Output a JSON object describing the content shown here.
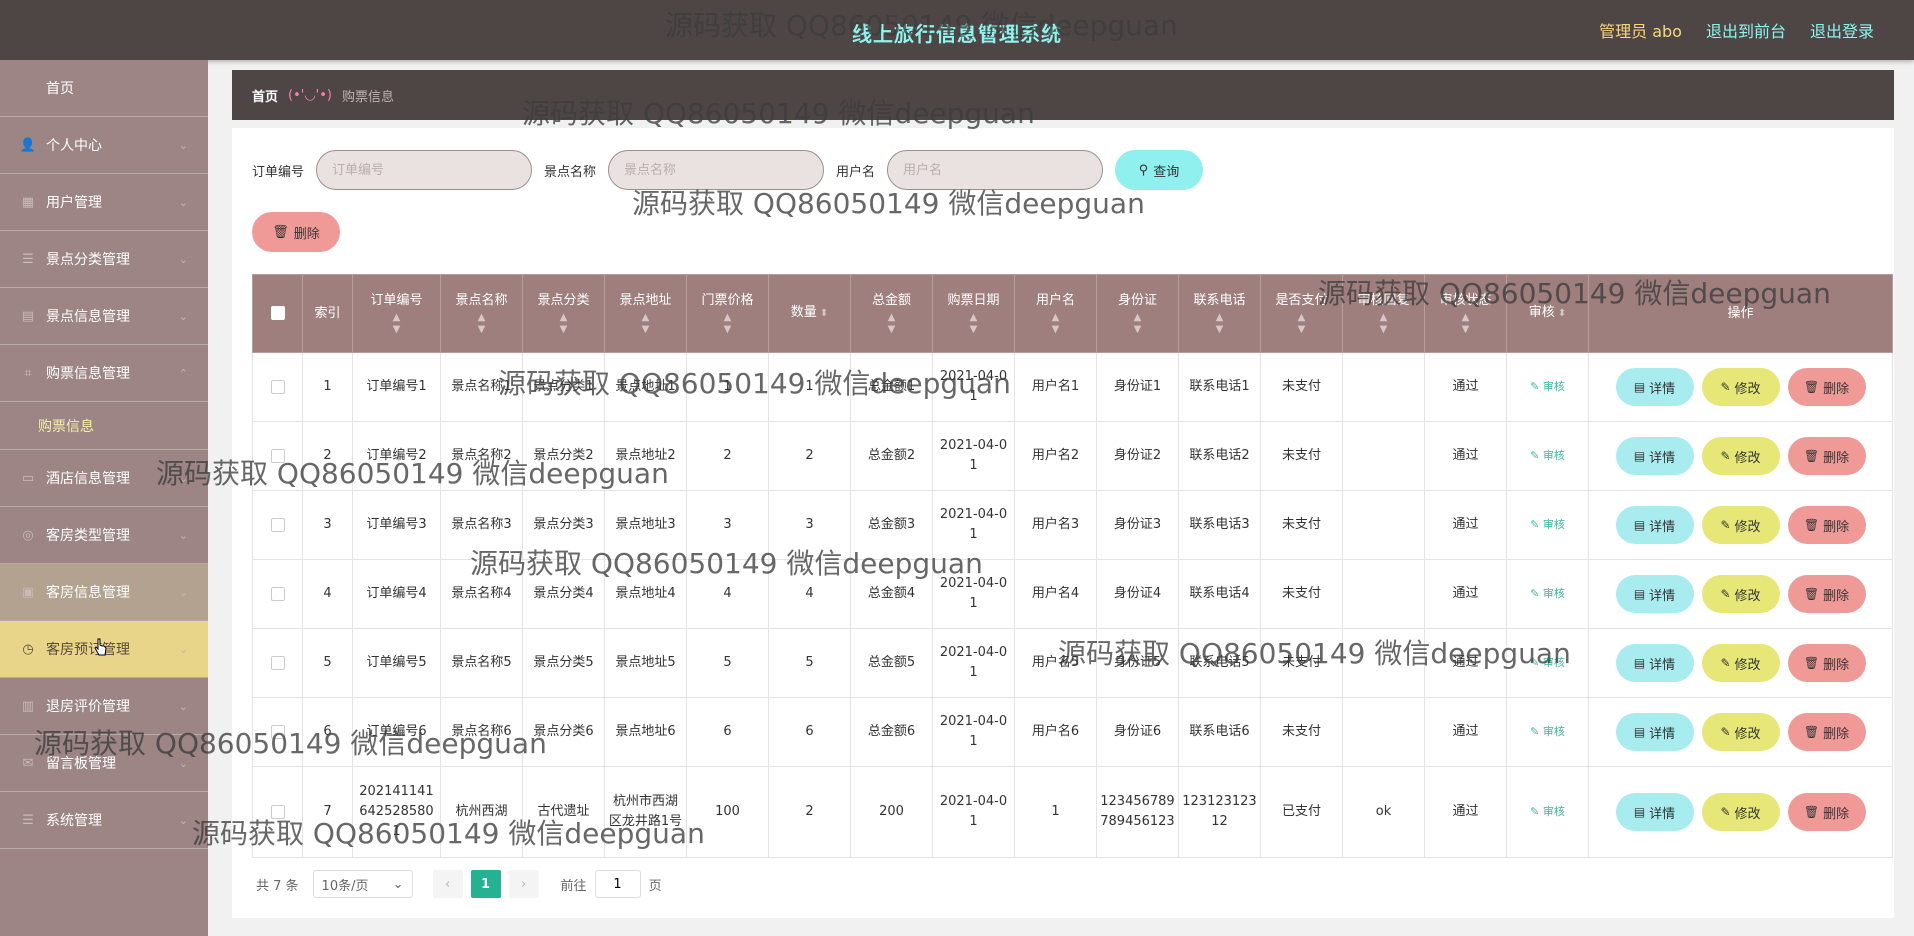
{
  "header": {
    "title": "线上旅行信息管理系统",
    "admin_label": "管理员 abo",
    "front_link": "退出到前台",
    "logout_link": "退出登录"
  },
  "sidebar": {
    "home": "首页",
    "items": [
      {
        "label": "个人中心",
        "icon": "person-icon"
      },
      {
        "label": "用户管理",
        "icon": "user-icon"
      },
      {
        "label": "景点分类管理",
        "icon": "list-icon"
      },
      {
        "label": "景点信息管理",
        "icon": "list-icon"
      },
      {
        "label": "购票信息管理",
        "icon": "ticket-icon"
      },
      {
        "label": "酒店信息管理",
        "icon": "hotel-icon"
      },
      {
        "label": "客房类型管理",
        "icon": "room-icon"
      },
      {
        "label": "客房信息管理",
        "icon": "room-icon"
      },
      {
        "label": "客房预订管理",
        "icon": "booking-icon"
      },
      {
        "label": "退房评价管理",
        "icon": "comment-icon"
      },
      {
        "label": "留言板管理",
        "icon": "message-icon"
      },
      {
        "label": "系统管理",
        "icon": "settings-icon"
      }
    ],
    "submenu_label": "购票信息"
  },
  "breadcrumb": {
    "home": "首页",
    "separator": "(•'◡'•)",
    "current": "购票信息"
  },
  "search": {
    "order_label": "订单编号",
    "order_placeholder": "订单编号",
    "spot_label": "景点名称",
    "spot_placeholder": "景点名称",
    "user_label": "用户名",
    "user_placeholder": "用户名",
    "query_button": "查询",
    "delete_button": "删除"
  },
  "table": {
    "columns": [
      "索引",
      "订单编号",
      "景点名称",
      "景点分类",
      "景点地址",
      "门票价格",
      "数量",
      "总金额",
      "购票日期",
      "用户名",
      "身份证",
      "联系电话",
      "是否支付",
      "审核回复",
      "审核状态",
      "审核",
      "操作"
    ],
    "audit_link": "审核",
    "btn_detail": "详情",
    "btn_edit": "修改",
    "btn_delete": "删除",
    "rows": [
      {
        "index": "1",
        "order": "订单编号1",
        "spot": "景点名称1",
        "category": "景点分类1",
        "address": "景点地址1",
        "price": "1",
        "qty": "1",
        "total": "总金额1",
        "date": "2021-04-01",
        "user": "用户名1",
        "idcard": "身份证1",
        "phone": "联系电话1",
        "paid": "未支付",
        "reply": "",
        "status": "通过"
      },
      {
        "index": "2",
        "order": "订单编号2",
        "spot": "景点名称2",
        "category": "景点分类2",
        "address": "景点地址2",
        "price": "2",
        "qty": "2",
        "total": "总金额2",
        "date": "2021-04-01",
        "user": "用户名2",
        "idcard": "身份证2",
        "phone": "联系电话2",
        "paid": "未支付",
        "reply": "",
        "status": "通过"
      },
      {
        "index": "3",
        "order": "订单编号3",
        "spot": "景点名称3",
        "category": "景点分类3",
        "address": "景点地址3",
        "price": "3",
        "qty": "3",
        "total": "总金额3",
        "date": "2021-04-01",
        "user": "用户名3",
        "idcard": "身份证3",
        "phone": "联系电话3",
        "paid": "未支付",
        "reply": "",
        "status": "通过"
      },
      {
        "index": "4",
        "order": "订单编号4",
        "spot": "景点名称4",
        "category": "景点分类4",
        "address": "景点地址4",
        "price": "4",
        "qty": "4",
        "total": "总金额4",
        "date": "2021-04-01",
        "user": "用户名4",
        "idcard": "身份证4",
        "phone": "联系电话4",
        "paid": "未支付",
        "reply": "",
        "status": "通过"
      },
      {
        "index": "5",
        "order": "订单编号5",
        "spot": "景点名称5",
        "category": "景点分类5",
        "address": "景点地址5",
        "price": "5",
        "qty": "5",
        "total": "总金额5",
        "date": "2021-04-01",
        "user": "用户名5",
        "idcard": "身份证5",
        "phone": "联系电话5",
        "paid": "未支付",
        "reply": "",
        "status": "通过"
      },
      {
        "index": "6",
        "order": "订单编号6",
        "spot": "景点名称6",
        "category": "景点分类6",
        "address": "景点地址6",
        "price": "6",
        "qty": "6",
        "total": "总金额6",
        "date": "2021-04-01",
        "user": "用户名6",
        "idcard": "身份证6",
        "phone": "联系电话6",
        "paid": "未支付",
        "reply": "",
        "status": "通过"
      },
      {
        "index": "7",
        "order": "2021411416425285801",
        "spot": "杭州西湖",
        "category": "古代遗址",
        "address": "杭州市西湖区龙井路1号",
        "price": "100",
        "qty": "2",
        "total": "200",
        "date": "2021-04-01",
        "user": "1",
        "idcard": "123456789789456123",
        "phone": "12312312312",
        "paid": "已支付",
        "reply": "ok",
        "status": "通过"
      }
    ]
  },
  "pagination": {
    "total": "共 7 条",
    "page_size": "10条/页",
    "current_page": "1",
    "goto_label": "前往",
    "goto_value": "1",
    "page_suffix": "页"
  },
  "watermark": "源码获取 QQ86050149 微信deepguan",
  "colors": {
    "header_bg": "#4e4645",
    "sidebar_bg": "#9c8584",
    "title_color": "#8ff3ee",
    "table_head_bg": "#9e7f7d",
    "accent_green": "#24b293"
  }
}
